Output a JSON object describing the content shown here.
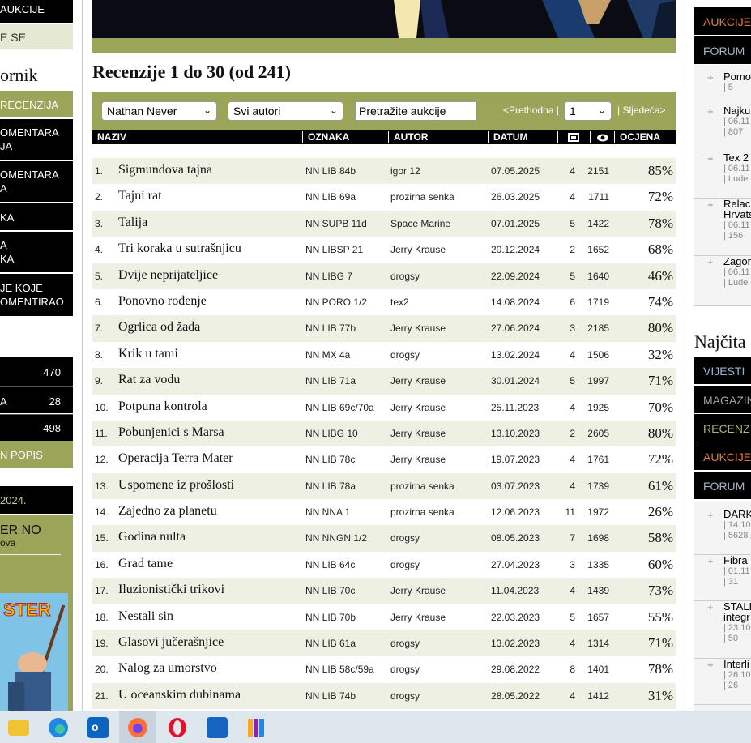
{
  "left_column": {
    "nav_top": [
      "AUKCIJE",
      "E SE"
    ],
    "section_title": "ornik",
    "menu": [
      "RECENZIJA",
      "OMENTARA\nJA",
      "OMENTARA\nA",
      "KA",
      "A\nKA",
      "JE KOJE\nOMENTIRAO"
    ],
    "stats": [
      {
        "label": "",
        "value": "470"
      },
      {
        "label": "A",
        "value": "28"
      },
      {
        "label": "",
        "value": "498"
      }
    ],
    "stats_link": "N POPIS",
    "date_label": "2024.",
    "promo_title": "ER NO",
    "promo_sub": "ova",
    "cover_text": "STER"
  },
  "main": {
    "title": "Recenzije 1 do 30 (od 241)",
    "filters": {
      "series_select": "Nathan Never",
      "author_select": "Svi autori",
      "search_value": "Pretražite aukcije",
      "prev_label": "<Prethodna |",
      "page_select": "1",
      "next_label": "| Sljedeća>"
    },
    "columns": [
      "NAZIV",
      "OZNAKA",
      "AUTOR",
      "DATUM",
      "comments-icon",
      "views-icon",
      "OCJENA"
    ],
    "rows": [
      {
        "n": "1.",
        "name": "Sigmundova tajna",
        "code": "NN LIB 84b",
        "author": "igor 12",
        "date": "07.05.2025",
        "comments": "4",
        "views": "2151",
        "rating": "85%"
      },
      {
        "n": "2.",
        "name": "Tajni rat",
        "code": "NN LIB 69a",
        "author": "prozirna senka",
        "date": "26.03.2025",
        "comments": "4",
        "views": "1711",
        "rating": "72%"
      },
      {
        "n": "3.",
        "name": "Talija",
        "code": "NN SUPB 11d",
        "author": "Space Marine",
        "date": "07.01.2025",
        "comments": "5",
        "views": "1422",
        "rating": "78%"
      },
      {
        "n": "4.",
        "name": "Tri koraka u sutrašnjicu",
        "code": "NN LIBSP 21",
        "author": "Jerry Krause",
        "date": "20.12.2024",
        "comments": "2",
        "views": "1652",
        "rating": "68%"
      },
      {
        "n": "5.",
        "name": "Dvije neprijateljice",
        "code": "NN LIBG 7",
        "author": "drogsy",
        "date": "22.09.2024",
        "comments": "5",
        "views": "1640",
        "rating": "46%"
      },
      {
        "n": "6.",
        "name": "Ponovno rođenje",
        "code": "NN PORO 1/2",
        "author": "tex2",
        "date": "14.08.2024",
        "comments": "6",
        "views": "1719",
        "rating": "74%"
      },
      {
        "n": "7.",
        "name": "Ogrlica od žada",
        "code": "NN LIB 77b",
        "author": "Jerry Krause",
        "date": "27.06.2024",
        "comments": "3",
        "views": "2185",
        "rating": "80%"
      },
      {
        "n": "8.",
        "name": "Krik u tami",
        "code": "NN MX 4a",
        "author": "drogsy",
        "date": "13.02.2024",
        "comments": "4",
        "views": "1506",
        "rating": "32%"
      },
      {
        "n": "9.",
        "name": "Rat za vodu",
        "code": "NN LIB 71a",
        "author": "Jerry Krause",
        "date": "30.01.2024",
        "comments": "5",
        "views": "1997",
        "rating": "71%"
      },
      {
        "n": "10.",
        "name": "Potpuna kontrola",
        "code": "NN LIB 69c/70a",
        "author": "Jerry Krause",
        "date": "25.11.2023",
        "comments": "4",
        "views": "1925",
        "rating": "70%"
      },
      {
        "n": "11.",
        "name": "Pobunjenici s Marsa",
        "code": "NN LIBG 10",
        "author": "Jerry Krause",
        "date": "13.10.2023",
        "comments": "2",
        "views": "2605",
        "rating": "80%"
      },
      {
        "n": "12.",
        "name": "Operacija Terra Mater",
        "code": "NN LIB 78c",
        "author": "Jerry Krause",
        "date": "19.07.2023",
        "comments": "4",
        "views": "1761",
        "rating": "72%"
      },
      {
        "n": "13.",
        "name": "Uspomene iz prošlosti",
        "code": "NN LIB 78a",
        "author": "prozirna senka",
        "date": "03.07.2023",
        "comments": "4",
        "views": "1739",
        "rating": "61%"
      },
      {
        "n": "14.",
        "name": "Zajedno za planetu",
        "code": "NN NNA 1",
        "author": "prozirna senka",
        "date": "12.06.2023",
        "comments": "11",
        "views": "1972",
        "rating": "26%"
      },
      {
        "n": "15.",
        "name": "Godina nulta",
        "code": "NN NNGN 1/2",
        "author": "drogsy",
        "date": "08.05.2023",
        "comments": "7",
        "views": "1698",
        "rating": "58%"
      },
      {
        "n": "16.",
        "name": "Grad tame",
        "code": "NN LIB 64c",
        "author": "drogsy",
        "date": "27.04.2023",
        "comments": "3",
        "views": "1335",
        "rating": "60%"
      },
      {
        "n": "17.",
        "name": "Iluzionistički trikovi",
        "code": "NN LIB 70c",
        "author": "Jerry Krause",
        "date": "11.04.2023",
        "comments": "4",
        "views": "1439",
        "rating": "73%"
      },
      {
        "n": "18.",
        "name": "Nestali sin",
        "code": "NN LIB 70b",
        "author": "Jerry Krause",
        "date": "22.03.2023",
        "comments": "5",
        "views": "1657",
        "rating": "55%"
      },
      {
        "n": "19.",
        "name": "Glasovi jučerašnjice",
        "code": "NN LIB 61a",
        "author": "drogsy",
        "date": "13.02.2023",
        "comments": "4",
        "views": "1314",
        "rating": "71%"
      },
      {
        "n": "20.",
        "name": "Nalog za umorstvo",
        "code": "NN LIB 58c/59a",
        "author": "drogsy",
        "date": "29.08.2022",
        "comments": "8",
        "views": "1401",
        "rating": "78%"
      },
      {
        "n": "21.",
        "name": "U oceanskim dubinama",
        "code": "NN LIB 74b",
        "author": "drogsy",
        "date": "28.05.2022",
        "comments": "4",
        "views": "1412",
        "rating": "31%"
      }
    ]
  },
  "right_column": {
    "tabs_top": [
      {
        "label": "AUKCIJE",
        "color": "#e07b39"
      },
      {
        "label": "FORUM",
        "color": "#9fb6c8"
      }
    ],
    "items_top": [
      {
        "title": "Pomo",
        "meta": "| 5"
      },
      {
        "title": "Najku",
        "meta": "| 06.11\n| 807"
      },
      {
        "title": "Tex 2",
        "meta": "| 06.11\n| Lude"
      },
      {
        "title": "Relac\nHrvats",
        "meta": "| 06.11\n| 156"
      },
      {
        "title": "Zagor",
        "meta": "| 06.11\n| Lude"
      }
    ],
    "section_title": "Najčita",
    "tabs_bottom": [
      {
        "label": "VIJESTI",
        "color": "#8fb6d8"
      },
      {
        "label": "MAGAZIN",
        "color": "#9aa59a"
      },
      {
        "label": "RECENZ",
        "color": "#a9b46a"
      },
      {
        "label": "AUKCIJE",
        "color": "#e07b39"
      },
      {
        "label": "FORUM",
        "color": "#9fb6c8"
      }
    ],
    "items_bottom": [
      {
        "title": "DARK",
        "meta": "| 14.10\n| 5628"
      },
      {
        "title": "Fibra",
        "meta": "| 01.11\n| 31"
      },
      {
        "title": "STALI\nintegr",
        "meta": "| 23.10\n| 50"
      },
      {
        "title": "Interli",
        "meta": "| 26.10\n| 26"
      }
    ]
  },
  "taskbar": {
    "icons": [
      "file-explorer-icon",
      "edge-icon",
      "outlook-icon",
      "firefox-icon",
      "opera-icon",
      "store-icon",
      "app-icon"
    ],
    "colors": {
      "bg": "#dfe7ee",
      "accent": "#9aa55a"
    }
  }
}
